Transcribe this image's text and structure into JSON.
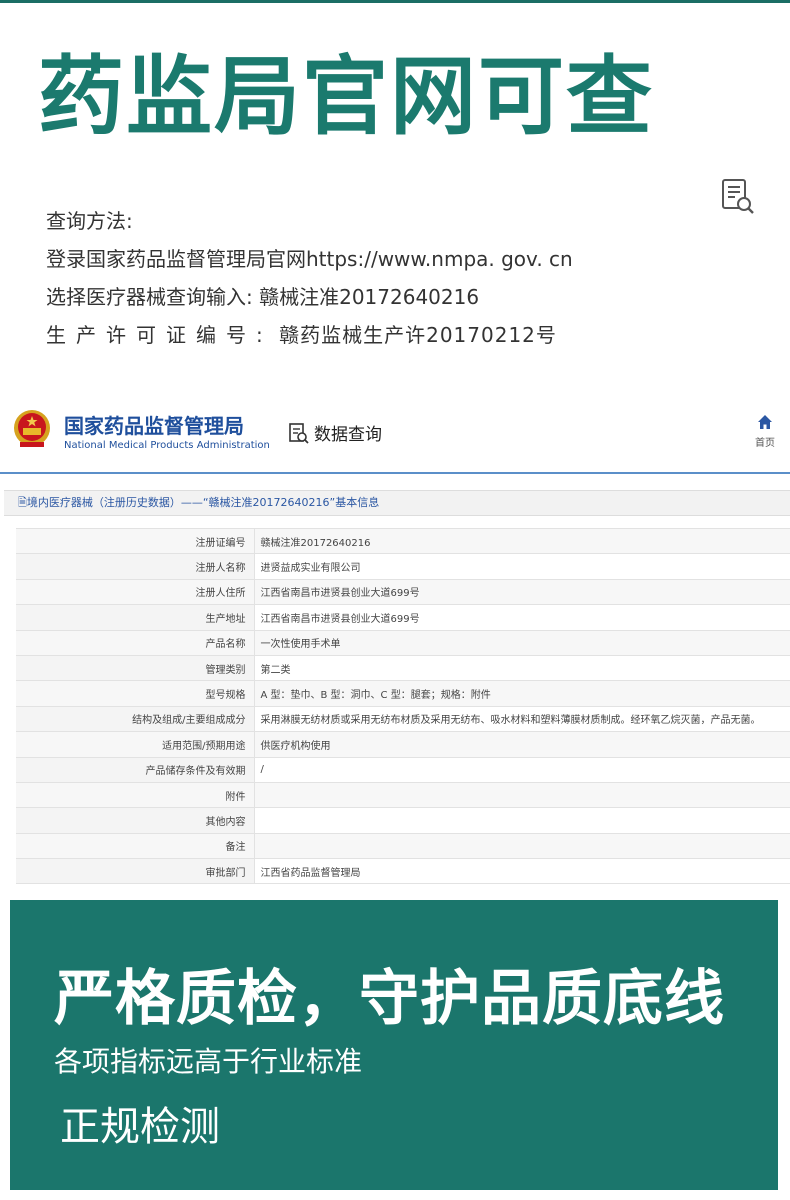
{
  "headline": "药监局官网可查",
  "instructions": {
    "method_label": "查询方法:",
    "login_line": "登录国家药品监督管理局官网https://www.nmpa. gov. cn",
    "select_line": "选择医疗器械查询输入: 赣械注准20172640216",
    "license_label": "生产许可证编号:",
    "license_value": "赣药监械生产许20170212号"
  },
  "nmpa": {
    "title_cn": "国家药品监督管理局",
    "title_en": "National Medical Products Administration",
    "data_query": "数据查询",
    "home_label": "首页",
    "section_title": "境内医疗器械（注册历史数据）——“赣械注准20172640216”基本信息",
    "rows": [
      {
        "label": "注册证编号",
        "value": "赣械注准20172640216"
      },
      {
        "label": "注册人名称",
        "value": "进贤益成实业有限公司"
      },
      {
        "label": "注册人住所",
        "value": "江西省南昌市进贤县创业大道699号"
      },
      {
        "label": "生产地址",
        "value": "江西省南昌市进贤县创业大道699号"
      },
      {
        "label": "产品名称",
        "value": "一次性使用手术单"
      },
      {
        "label": "管理类别",
        "value": "第二类"
      },
      {
        "label": "型号规格",
        "value": "A 型：垫巾、B 型：洞巾、C 型：腿套；规格：附件"
      },
      {
        "label": "结构及组成/主要组成成分",
        "value": "采用淋膜无纺材质或采用无纺布材质及采用无纺布、吸水材料和塑料薄膜材质制成。经环氧乙烷灭菌，产品无菌。"
      },
      {
        "label": "适用范围/预期用途",
        "value": "供医疗机构使用"
      },
      {
        "label": "产品储存条件及有效期",
        "value": "/"
      },
      {
        "label": "附件",
        "value": ""
      },
      {
        "label": "其他内容",
        "value": ""
      },
      {
        "label": "备注",
        "value": ""
      },
      {
        "label": "审批部门",
        "value": "江西省药品监督管理局"
      }
    ]
  },
  "banner": {
    "title": "严格质检，守护品质底线",
    "subtitle": "各项指标远高于行业标准",
    "tag": "正规检测"
  },
  "colors": {
    "accent": "#1b7a6e",
    "banner_bg": "#1b766c",
    "nmpa_blue": "#1f4f9c"
  },
  "icons": [
    "document-search-icon",
    "national-emblem-icon",
    "data-query-icon",
    "home-icon"
  ]
}
